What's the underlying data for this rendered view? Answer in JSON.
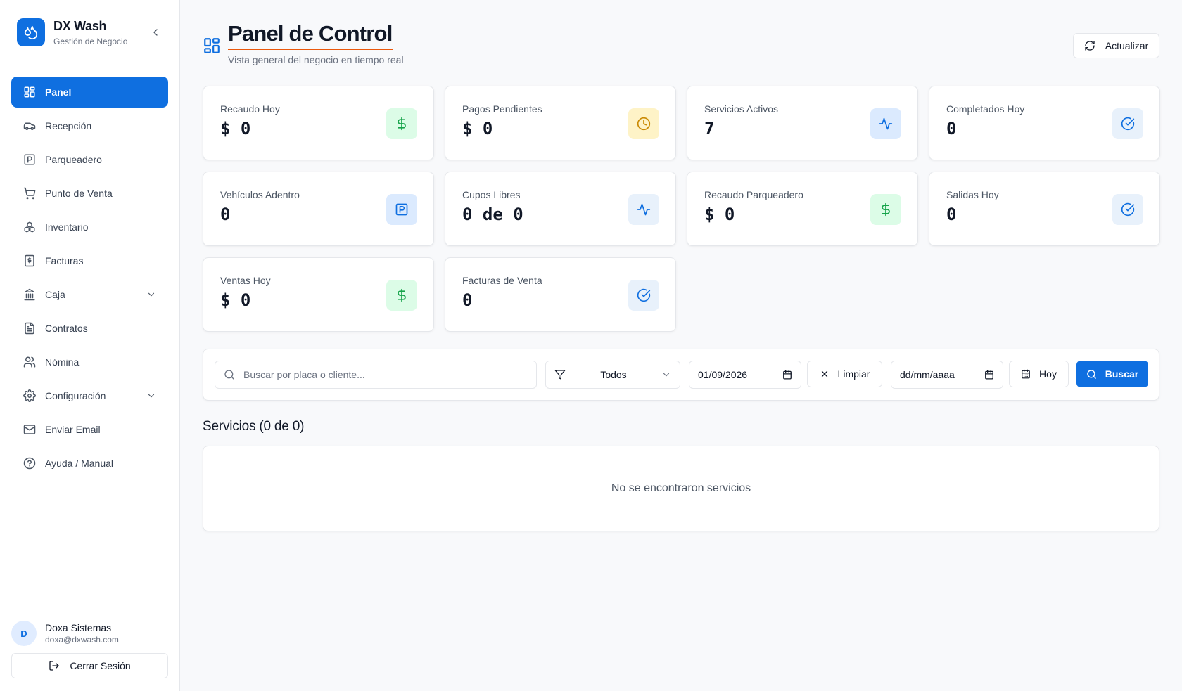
{
  "brand": {
    "name": "DX Wash",
    "subtitle": "Gestión de Negocio"
  },
  "sidebar": {
    "items": [
      {
        "label": "Panel",
        "icon": "grid-icon",
        "active": true
      },
      {
        "label": "Recepción",
        "icon": "car-icon"
      },
      {
        "label": "Parqueadero",
        "icon": "parking-icon"
      },
      {
        "label": "Punto de Venta",
        "icon": "cart-icon"
      },
      {
        "label": "Inventario",
        "icon": "boxes-icon"
      },
      {
        "label": "Facturas",
        "icon": "invoice-icon"
      },
      {
        "label": "Caja",
        "icon": "bank-icon",
        "expandable": true
      },
      {
        "label": "Contratos",
        "icon": "document-icon"
      },
      {
        "label": "Nómina",
        "icon": "users-icon"
      },
      {
        "label": "Configuración",
        "icon": "gear-icon",
        "expandable": true
      },
      {
        "label": "Enviar Email",
        "icon": "mail-icon"
      },
      {
        "label": "Ayuda / Manual",
        "icon": "help-icon"
      }
    ]
  },
  "user": {
    "initial": "D",
    "name": "Doxa Sistemas",
    "email": "doxa@dxwash.com",
    "logout_label": "Cerrar Sesión"
  },
  "header": {
    "title": "Panel de Control",
    "subtitle": "Vista general del negocio en tiempo real",
    "refresh_label": "Actualizar"
  },
  "stats": [
    {
      "label": "Recaudo Hoy",
      "value": "$ 0",
      "icon": "dollar-icon",
      "tone": "green"
    },
    {
      "label": "Pagos Pendientes",
      "value": "$ 0",
      "icon": "clock-icon",
      "tone": "yellow"
    },
    {
      "label": "Servicios Activos",
      "value": "7",
      "icon": "activity-icon",
      "tone": "blue"
    },
    {
      "label": "Completados Hoy",
      "value": "0",
      "icon": "check-circle-icon",
      "tone": "lightblue"
    },
    {
      "label": "Vehículos Adentro",
      "value": "0",
      "icon": "parking-icon",
      "tone": "blue"
    },
    {
      "label": "Cupos Libres",
      "value": "0 de 0",
      "icon": "activity-icon",
      "tone": "lightblue"
    },
    {
      "label": "Recaudo Parqueadero",
      "value": "$ 0",
      "icon": "dollar-icon",
      "tone": "green"
    },
    {
      "label": "Salidas Hoy",
      "value": "0",
      "icon": "check-circle-icon",
      "tone": "lightblue"
    },
    {
      "label": "Ventas Hoy",
      "value": "$ 0",
      "icon": "dollar-icon",
      "tone": "green"
    },
    {
      "label": "Facturas de Venta",
      "value": "0",
      "icon": "check-circle-icon",
      "tone": "lightblue"
    }
  ],
  "filters": {
    "search_placeholder": "Buscar por placa o cliente...",
    "status_value": "Todos",
    "date_from": "01/09/2026",
    "clear_label": "Limpiar",
    "date_to": "dd/mm/aaaa",
    "today_label": "Hoy",
    "search_label": "Buscar"
  },
  "services": {
    "title": "Servicios (0 de 0)",
    "empty_message": "No se encontraron servicios"
  },
  "colors": {
    "primary": "#0f6fe0",
    "accent_underline": "#ea580c",
    "green": "#16a34a",
    "yellow": "#ca8a04"
  }
}
